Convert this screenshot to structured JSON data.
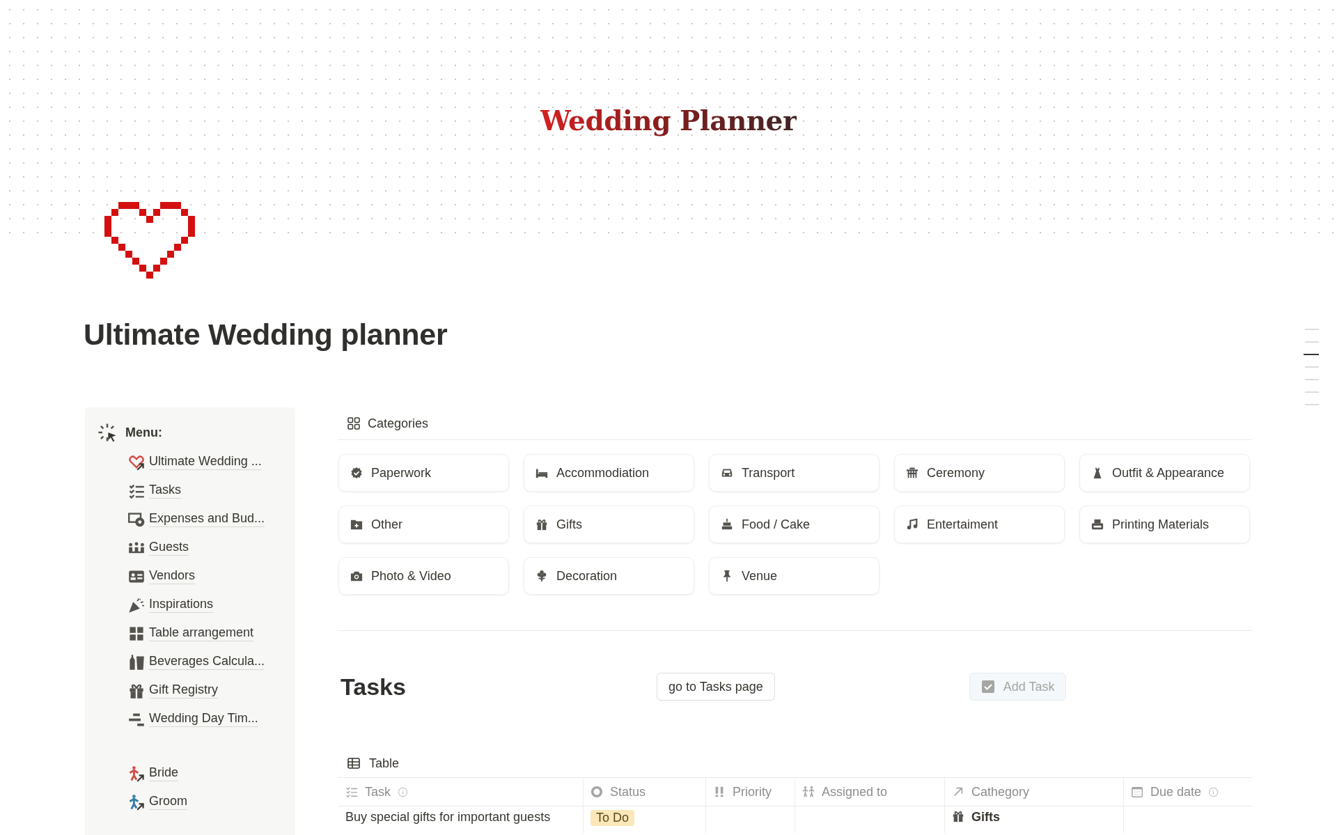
{
  "cover": {
    "title": "Wedding Planner"
  },
  "page": {
    "title": "Ultimate Wedding planner"
  },
  "menu": {
    "title": "Menu:",
    "items": [
      {
        "label": "Ultimate Wedding ..."
      },
      {
        "label": "Tasks"
      },
      {
        "label": "Expenses and Bud..."
      },
      {
        "label": "Guests"
      },
      {
        "label": "Vendors"
      },
      {
        "label": "Inspirations"
      },
      {
        "label": "Table arrangement"
      },
      {
        "label": "Beverages Calcula..."
      },
      {
        "label": "Gift Registry"
      },
      {
        "label": "Wedding Day Tim..."
      }
    ],
    "people": [
      {
        "label": "Bride",
        "color": "#d44c47"
      },
      {
        "label": "Groom",
        "color": "#337ea9"
      }
    ]
  },
  "categories": {
    "view": "Categories",
    "items": [
      {
        "label": "Paperwork"
      },
      {
        "label": "Accommodiation"
      },
      {
        "label": "Transport"
      },
      {
        "label": "Ceremony"
      },
      {
        "label": "Outfit & Appearance"
      },
      {
        "label": "Other"
      },
      {
        "label": "Gifts"
      },
      {
        "label": "Food / Cake"
      },
      {
        "label": "Entertaiment"
      },
      {
        "label": "Printing Materials"
      },
      {
        "label": "Photo & Video"
      },
      {
        "label": "Decoration"
      },
      {
        "label": "Venue"
      }
    ]
  },
  "tasks": {
    "title": "Tasks",
    "buttons": [
      {
        "label": "go to Tasks page",
        "kind": "outline"
      },
      {
        "label": "Add Task",
        "kind": "tinted"
      }
    ],
    "table": {
      "view": "Table",
      "columns": [
        {
          "label": "Task",
          "info": true
        },
        {
          "label": "Status",
          "info": false
        },
        {
          "label": "Priority",
          "info": false
        },
        {
          "label": "Assigned to",
          "info": false
        },
        {
          "label": "Cathegory",
          "info": false
        },
        {
          "label": "Due date",
          "info": true
        }
      ],
      "rows": [
        {
          "task": "Buy special gifts for important guests",
          "status": "To Do",
          "category": "Gifts"
        }
      ]
    }
  },
  "outline": {
    "markers": [
      {
        "selected": false
      },
      {
        "selected": false
      },
      {
        "selected": true
      },
      {
        "selected": false
      },
      {
        "selected": false
      },
      {
        "selected": false
      },
      {
        "selected": false
      }
    ]
  }
}
